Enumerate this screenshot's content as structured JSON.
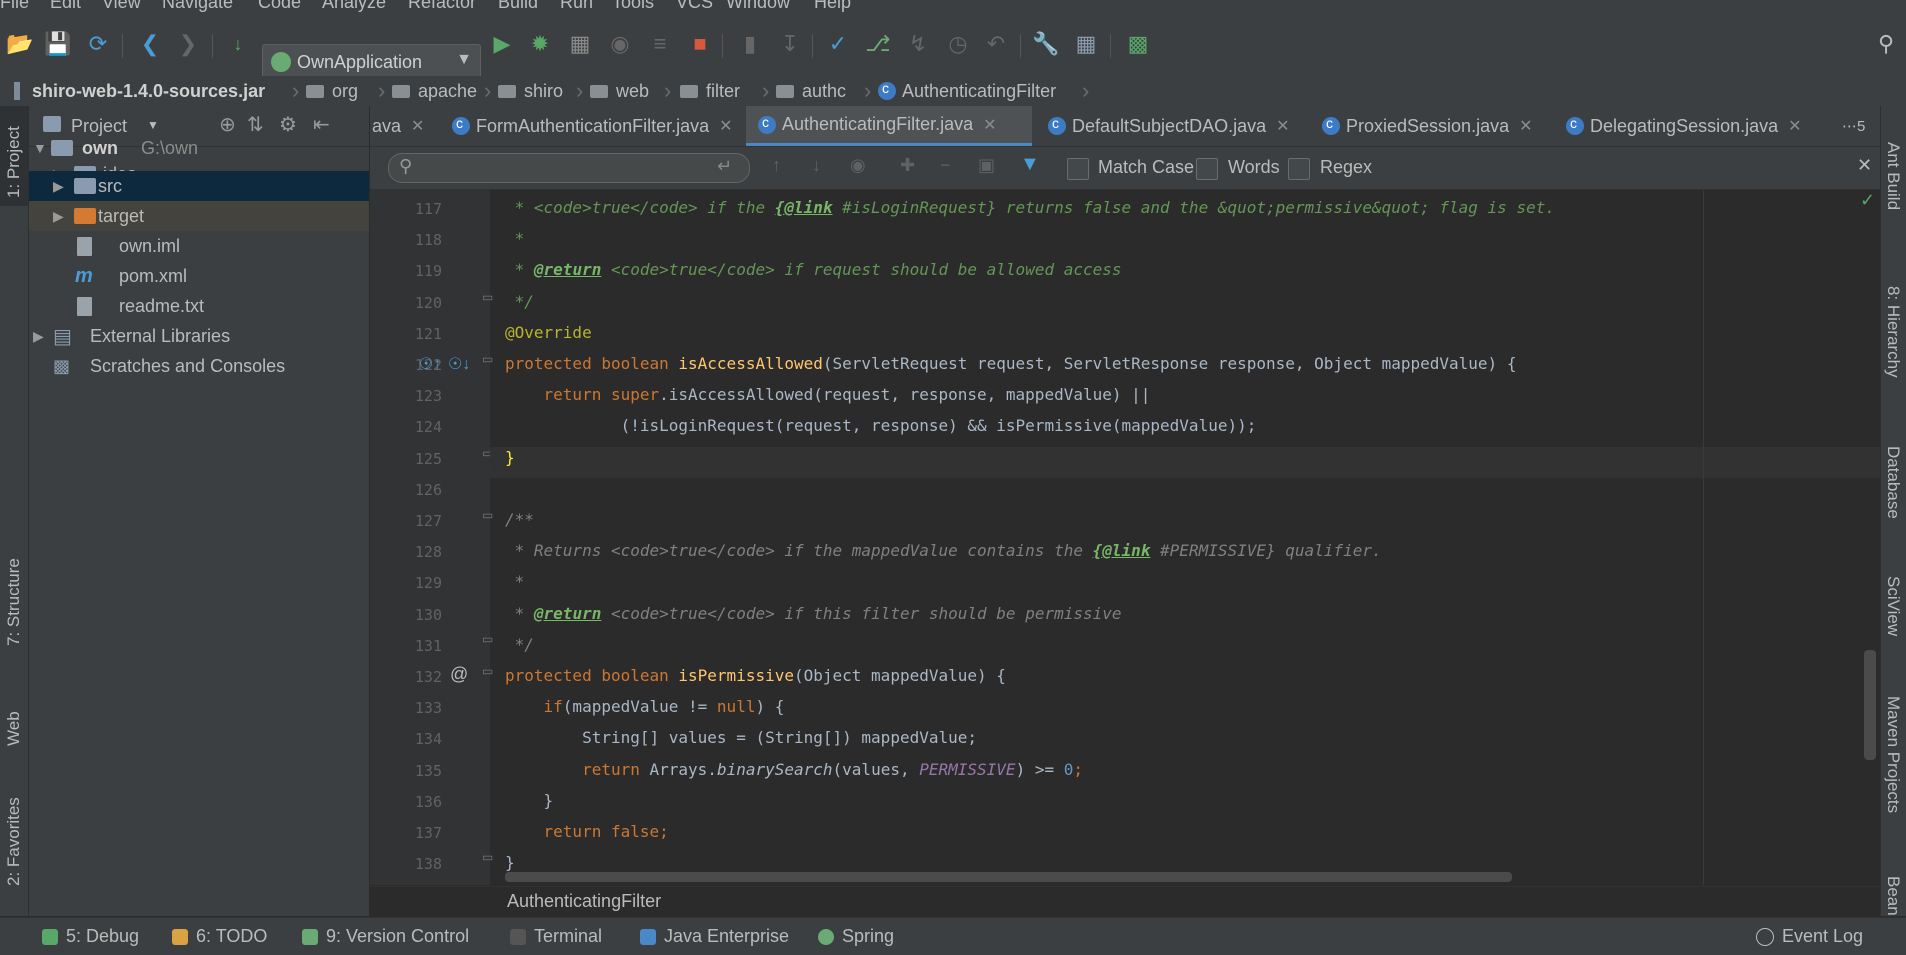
{
  "menu": [
    "File",
    "Edit",
    "View",
    "Navigate",
    "Code",
    "Analyze",
    "Refactor",
    "Build",
    "Run",
    "Tools",
    "VCS",
    "Window",
    "Help"
  ],
  "toolbar": {
    "run_config": "OwnApplication"
  },
  "breadcrumbs": [
    "shiro-web-1.4.0-sources.jar",
    "org",
    "apache",
    "shiro",
    "web",
    "filter",
    "authc",
    "AuthenticatingFilter"
  ],
  "left_strip": {
    "project": "1: Project",
    "structure": "7: Structure",
    "web": "Web",
    "favorites": "2: Favorites"
  },
  "project_panel": {
    "title": "Project",
    "tree": [
      {
        "label": "own",
        "extra": "G:\\own"
      },
      {
        "label": ".idea"
      },
      {
        "label": "src"
      },
      {
        "label": "target"
      },
      {
        "label": "own.iml"
      },
      {
        "label": "pom.xml"
      },
      {
        "label": "readme.txt"
      },
      {
        "label": "External Libraries"
      },
      {
        "label": "Scratches and Consoles"
      }
    ]
  },
  "tabs": {
    "overflow_fragment": "ava",
    "items": [
      "FormAuthenticationFilter.java",
      "AuthenticatingFilter.java",
      "DefaultSubjectDAO.java",
      "ProxiedSession.java",
      "DelegatingSession.java"
    ],
    "more": "⋯5"
  },
  "search": {
    "match_case": "Match Case",
    "words": "Words",
    "regex": "Regex"
  },
  "editor": {
    "line_numbers": [
      "117",
      "118",
      "119",
      "120",
      "121",
      "122",
      "123",
      "124",
      "125",
      "126",
      "127",
      "128",
      "129",
      "130",
      "131",
      "132",
      "133",
      "134",
      "135",
      "136",
      "137",
      "138"
    ],
    "current_class": "AuthenticatingFilter",
    "code": {
      "l117a": " * <code>true</code> if the ",
      "l117b": "{@link",
      "l117c": " #isLoginRequest} returns false and the &quot;permissive&quot; flag is set.",
      "l118": " *",
      "l119a": " * ",
      "l119b": "@return",
      "l119c": " <code>true</code> if request should be allowed access",
      "l120": " */",
      "l121": "@Override",
      "l122a": "protected boolean ",
      "l122b": "isAccessAllowed",
      "l122c": "(ServletRequest request, ServletResponse response, Object mappedValue) {",
      "l123a": "    return super",
      "l123b": ".isAccessAllowed(request, response, mappedValue) ||",
      "l124": "            (!isLoginRequest(request, response) && isPermissive(mappedValue));",
      "l125": "}",
      "l127": "/**",
      "l128a": " * Returns <code>true</code> if the mappedValue contains the ",
      "l128b": "{@link",
      "l128c": " #PERMISSIVE} qualifier.",
      "l129": " *",
      "l130a": " * ",
      "l130b": "@return",
      "l130c": " <code>true</code> if this filter should be permissive",
      "l131": " */",
      "l132a": "protected boolean ",
      "l132b": "isPermissive",
      "l132c": "(Object mappedValue) {",
      "l133a": "    if",
      "l133b": "(mappedValue != ",
      "l133c": "null",
      "l133d": ") {",
      "l134": "        String[] values = (String[]) mappedValue;",
      "l135a": "        return ",
      "l135b": "Arrays.",
      "l135c": "binarySearch",
      "l135d": "(values, ",
      "l135e": "PERMISSIVE",
      "l135f": ") >= ",
      "l135g": "0",
      "l135h": ";",
      "l136": "    }",
      "l137": "    return false;",
      "l138": "}"
    }
  },
  "right_strip": [
    "Ant Build",
    "8: Hierarchy",
    "Database",
    "SciView",
    "Maven Projects",
    "Bean"
  ],
  "bottom_tools": [
    "5: Debug",
    "6: TODO",
    "9: Version Control",
    "Terminal",
    "Java Enterprise",
    "Spring"
  ],
  "event_log": "Event Log"
}
